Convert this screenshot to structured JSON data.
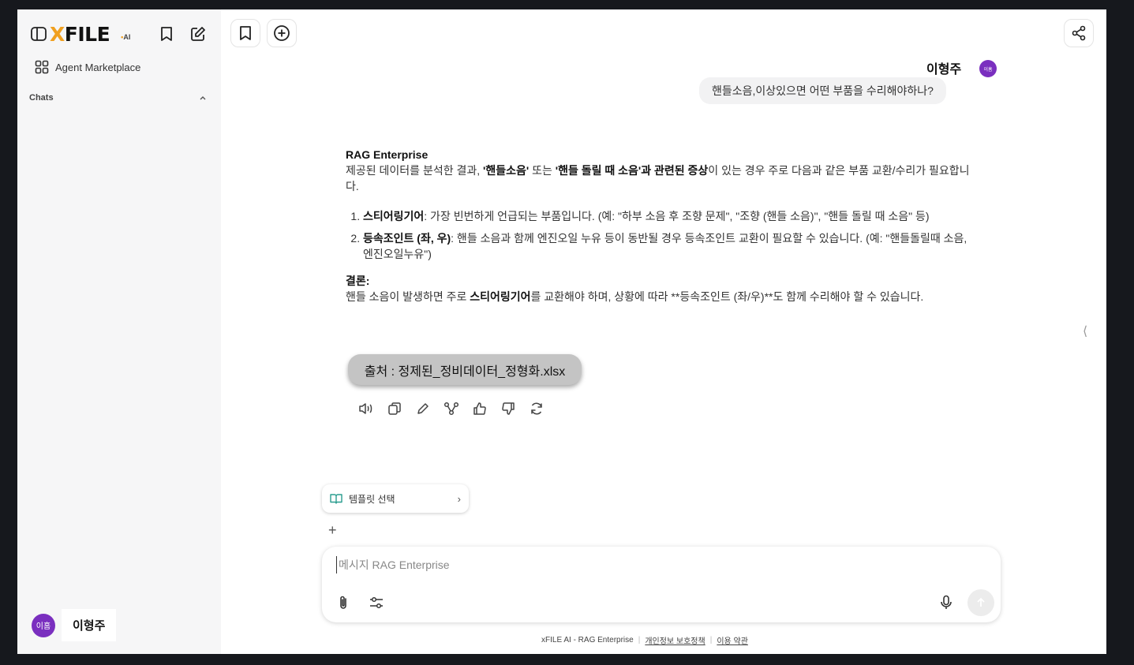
{
  "brand": {
    "logo_x": "X",
    "logo_rest": "FILE",
    "logo_ai_dot": "•",
    "logo_ai": "AI"
  },
  "sidebar": {
    "nav_item": "Agent Marketplace",
    "chats_label": "Chats",
    "user_avatar": "이홈",
    "user_name": "이형주"
  },
  "conversation": {
    "user_name": "이형주",
    "user_avatar": "이홈",
    "user_message": "핸들소음,이상있으면 어떤 부품을 수리해야하나?",
    "bot_name": "RAG Enterprise",
    "intro_1": "제공된 데이터를 분석한 결과, ",
    "intro_b1": "'핸들소음'",
    "intro_2": " 또는 ",
    "intro_b2": "'핸들 돌릴 때 소음'과 관련된 증상",
    "intro_3": "이 있는 경우 주로 다음과 같은 부품 교환/수리가 필요합니다.",
    "items": [
      {
        "title": "스티어링기어",
        "text": ": 가장 빈번하게 언급되는 부품입니다. (예: \"하부 소음 후 조향 문제\", \"조향 (핸들 소음)\", \"핸들 돌릴 때 소음\" 등)"
      },
      {
        "title": "등속조인트 (좌, 우)",
        "text": ": 핸들 소음과 함께 엔진오일 누유 등이 동반될 경우 등속조인트 교환이 필요할 수 있습니다. (예: \"핸들돌릴때 소음, 엔진오일누유\")"
      }
    ],
    "conclusion_title": "결론:",
    "conclusion_1": "핸들 소음이 발생하면 주로 ",
    "conclusion_b": "스티어링기어",
    "conclusion_2": "를 교환해야 하며, 상황에 따라 **등속조인트 (좌/우)**도 함께 수리해야 할 수 있습니다.",
    "source": "출처 : 정제된_정비데이터_정형화.xlsx"
  },
  "composer": {
    "template_label": "템플릿 선택",
    "placeholder": "메시지 RAG Enterprise",
    "plus": "+"
  },
  "footer": {
    "brand": "xFILE AI - RAG Enterprise",
    "privacy": "개인정보 보호정책",
    "terms": "이용 약관",
    "sep": "|"
  },
  "colors": {
    "accent": "#7a2fbf",
    "logo_orange": "#f0a020"
  }
}
